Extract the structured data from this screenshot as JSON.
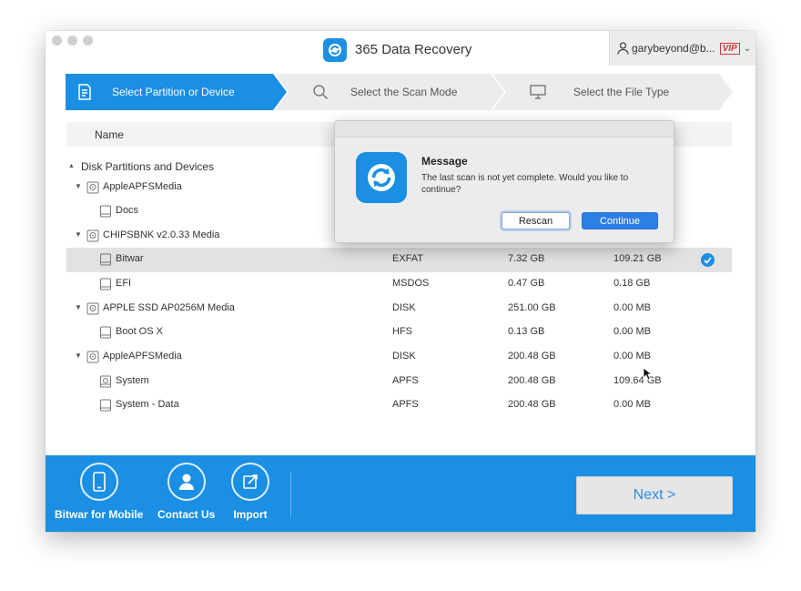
{
  "app": {
    "title": "365 Data Recovery",
    "account_user": "garybeyond@b...",
    "vip_badge": "VIP",
    "accent_color": "#1a8fe3"
  },
  "steps": [
    {
      "label": "Select Partition or Device",
      "icon": "document-icon",
      "active": true
    },
    {
      "label": "Select the Scan Mode",
      "icon": "search-icon",
      "active": false
    },
    {
      "label": "Select the File Type",
      "icon": "monitor-icon",
      "active": false
    }
  ],
  "table": {
    "header_name": "Name",
    "group_label": "Disk Partitions and Devices",
    "rows": [
      {
        "name": "AppleAPFSMedia",
        "type": "",
        "used": "",
        "free": "",
        "level": 0,
        "icon": "disk-icon"
      },
      {
        "name": "Docs",
        "type": "",
        "used": "",
        "free": "",
        "level": 1,
        "icon": "drive-icon"
      },
      {
        "name": "CHIPSBNK v2.0.33 Media",
        "type": "",
        "used": "",
        "free": "",
        "level": 0,
        "icon": "disk-icon"
      },
      {
        "name": "Bitwar",
        "type": "EXFAT",
        "used": "7.32 GB",
        "free": "109.21 GB",
        "level": 1,
        "icon": "drive-icon",
        "selected": true
      },
      {
        "name": "EFI",
        "type": "MSDOS",
        "used": "0.47 GB",
        "free": "0.18 GB",
        "level": 1,
        "icon": "drive-icon"
      },
      {
        "name": "APPLE SSD AP0256M Media",
        "type": "DISK",
        "used": "251.00 GB",
        "free": "0.00 MB",
        "level": 0,
        "icon": "disk-icon"
      },
      {
        "name": "Boot OS X",
        "type": "HFS",
        "used": "0.13 GB",
        "free": "0.00 MB",
        "level": 1,
        "icon": "drive-icon"
      },
      {
        "name": "AppleAPFSMedia",
        "type": "DISK",
        "used": "200.48 GB",
        "free": "0.00 MB",
        "level": 0,
        "icon": "disk-icon"
      },
      {
        "name": "System",
        "type": "APFS",
        "used": "200.48 GB",
        "free": "109.64 GB",
        "level": 1,
        "icon": "system-drive-icon"
      },
      {
        "name": "System - Data",
        "type": "APFS",
        "used": "200.48 GB",
        "free": "0.00 MB",
        "level": 1,
        "icon": "drive-icon"
      }
    ]
  },
  "footer": {
    "mobile_label": "Bitwar for Mobile",
    "contact_label": "Contact Us",
    "import_label": "Import",
    "next_label": "Next >"
  },
  "dialog": {
    "title": "Message",
    "message": "The last scan is not yet complete. Would you like to continue?",
    "rescan_label": "Rescan",
    "continue_label": "Continue"
  }
}
